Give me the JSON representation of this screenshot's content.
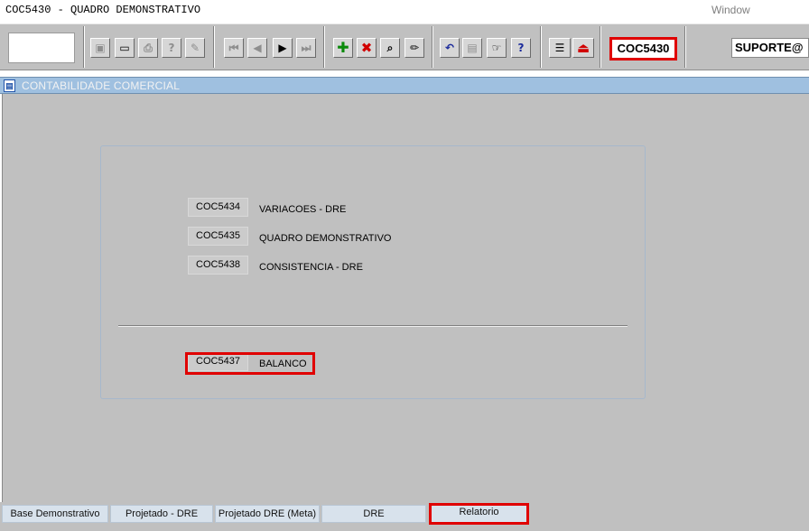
{
  "window": {
    "title": "COC5430 - QUADRO DEMONSTRATIVO",
    "menu": "Window"
  },
  "toolbar": {
    "program_code": "COC5430",
    "user": "SUPORTE@",
    "buttons": [
      {
        "name": "save-icon",
        "glyph": "▣",
        "style": "dim"
      },
      {
        "name": "screen-icon",
        "glyph": "▭",
        "style": ""
      },
      {
        "name": "print-icon",
        "glyph": "⎙",
        "style": "dim"
      },
      {
        "name": "query-icon",
        "glyph": "?",
        "style": "dim"
      },
      {
        "name": "edit-query-icon",
        "glyph": "✎",
        "style": "dim"
      },
      {
        "name": "first-record-icon",
        "glyph": "⏮",
        "style": "dim"
      },
      {
        "name": "previous-record-icon",
        "glyph": "◀",
        "style": "dim"
      },
      {
        "name": "next-record-icon",
        "glyph": "▶",
        "style": ""
      },
      {
        "name": "last-record-icon",
        "glyph": "⏭",
        "style": "dim"
      },
      {
        "name": "insert-record-icon",
        "glyph": "✚",
        "style": "green"
      },
      {
        "name": "delete-record-icon",
        "glyph": "✖",
        "style": "red"
      },
      {
        "name": "find-record-icon",
        "glyph": "⌕",
        "style": ""
      },
      {
        "name": "edit-record-icon",
        "glyph": "✏",
        "style": ""
      },
      {
        "name": "undo-icon",
        "glyph": "↶",
        "style": "blue"
      },
      {
        "name": "clipboard-icon",
        "glyph": "▤",
        "style": "dim"
      },
      {
        "name": "help-hand-icon",
        "glyph": "☞",
        "style": ""
      },
      {
        "name": "help-icon",
        "glyph": "?",
        "style": "blue"
      },
      {
        "name": "menu-icon",
        "glyph": "☰",
        "style": ""
      },
      {
        "name": "exit-icon",
        "glyph": "⏏",
        "style": "red"
      }
    ]
  },
  "panel": {
    "title": "CONTABILIDADE COMERCIAL"
  },
  "reports": [
    {
      "code": "COC5434",
      "label": "VARIACOES - DRE"
    },
    {
      "code": "COC5435",
      "label": "QUADRO DEMONSTRATIVO"
    },
    {
      "code": "COC5438",
      "label": "CONSISTENCIA - DRE"
    }
  ],
  "highlighted_report": {
    "code": "COC5437",
    "label": "BALANCO"
  },
  "tabs": [
    {
      "label": "Base Demonstrativo"
    },
    {
      "label": "Projetado - DRE"
    },
    {
      "label": "Projetado DRE (Meta)"
    },
    {
      "label": "DRE"
    },
    {
      "label": "Relatorio"
    }
  ],
  "active_tab": "Relatorio",
  "colors": {
    "highlight": "#e00000",
    "panel_header": "#9fc0e0",
    "background": "#c0c0c0"
  }
}
